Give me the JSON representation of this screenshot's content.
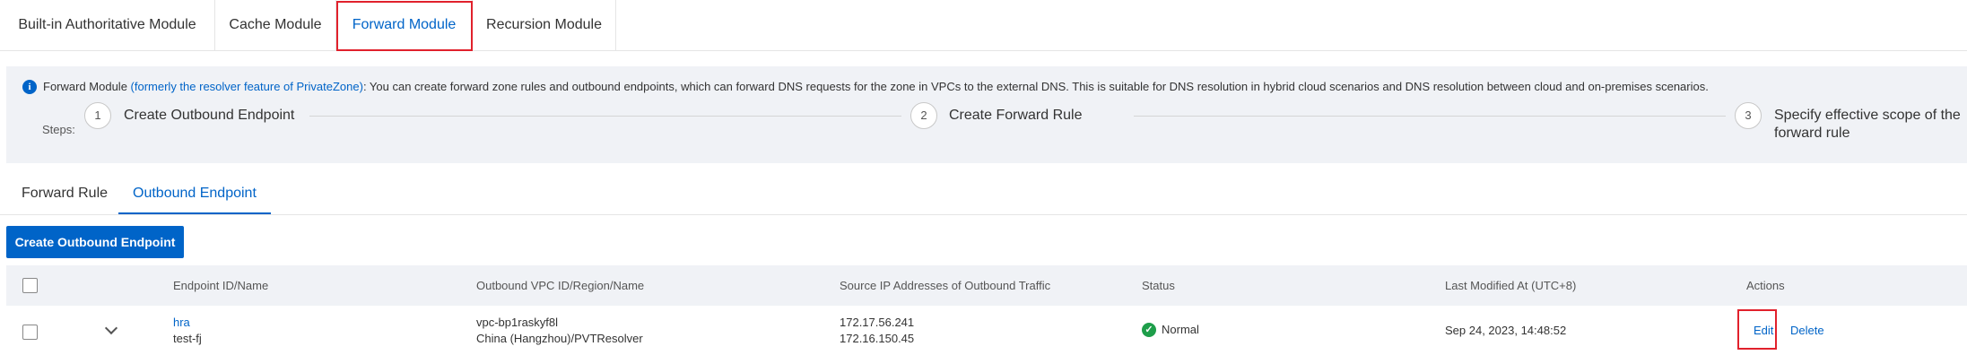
{
  "module_tabs": [
    {
      "label": "Built-in Authoritative Module"
    },
    {
      "label": "Cache Module"
    },
    {
      "label": "Forward Module"
    },
    {
      "label": "Recursion Module"
    }
  ],
  "info": {
    "prefix": "Forward Module ",
    "link": "(formerly the resolver feature of PrivateZone)",
    "suffix": ": You can create forward zone rules and outbound endpoints, which can forward DNS requests for the zone in VPCs to the external DNS. This is suitable for DNS resolution in hybrid cloud scenarios and DNS resolution between cloud and on-premises scenarios.",
    "steps_label": "Steps:",
    "steps": [
      {
        "number": "1",
        "title": "Create Outbound Endpoint"
      },
      {
        "number": "2",
        "title": "Create Forward Rule"
      },
      {
        "number": "3",
        "title_line1": "Specify effective scope of the",
        "title_line2": "forward rule"
      }
    ]
  },
  "sub_tabs": [
    {
      "label": "Forward Rule"
    },
    {
      "label": "Outbound Endpoint"
    }
  ],
  "create_button": "Create Outbound Endpoint",
  "table": {
    "headers": {
      "endpoint": "Endpoint ID/Name",
      "vpc": "Outbound VPC ID/Region/Name",
      "source_ip": "Source IP Addresses of Outbound Traffic",
      "status": "Status",
      "modified": "Last Modified At (UTC+8)",
      "actions": "Actions"
    },
    "rows": [
      {
        "endpoint_id": "hra",
        "endpoint_name": "test-fj",
        "vpc_id": "vpc-bp1raskyf8l",
        "vpc_region_name": "China (Hangzhou)/PVTResolver",
        "ip1": "172.17.56.241",
        "ip2": "172.16.150.45",
        "status": "Normal",
        "modified": "Sep 24, 2023, 14:48:52",
        "edit": "Edit",
        "delete": "Delete"
      }
    ]
  },
  "colors": {
    "accent": "#0064c8",
    "highlight": "#e1212c",
    "panel_bg": "#f0f2f6",
    "status_ok": "#1e9e4a"
  },
  "icons": {
    "info": "info-circle-icon",
    "status": "check-circle-icon",
    "expand": "chevron-down-icon"
  }
}
